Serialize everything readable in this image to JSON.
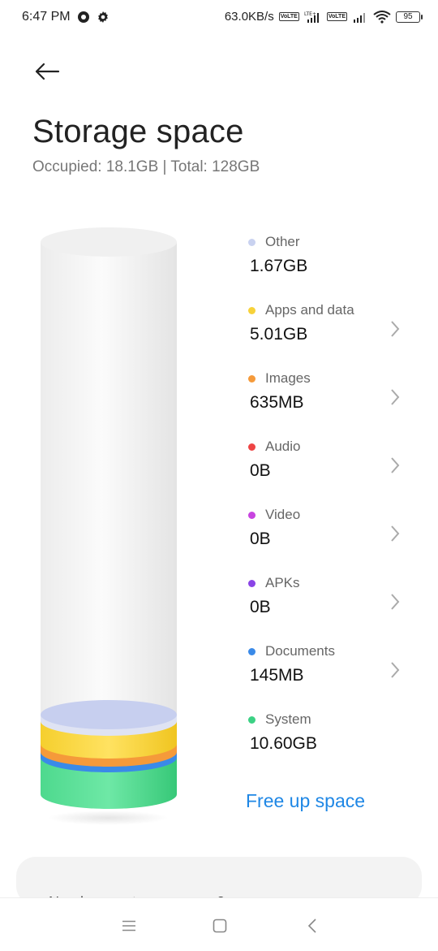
{
  "status_bar": {
    "time": "6:47 PM",
    "net_speed": "63.0KB/s",
    "lte_label": "LTE+",
    "volte_label": "Vo LTE",
    "battery": "95",
    "icons": [
      "circle-record-icon",
      "gear-icon",
      "volte-icon",
      "signal-icon",
      "wifi-icon",
      "battery-icon"
    ]
  },
  "header": {
    "title": "Storage space",
    "subtitle": "Occupied: 18.1GB | Total: 128GB"
  },
  "legend": [
    {
      "label": "Other",
      "value": "1.67GB",
      "color": "#c9d2f0",
      "chevron": false
    },
    {
      "label": "Apps and data",
      "value": "5.01GB",
      "color": "#f7d23a",
      "chevron": true
    },
    {
      "label": "Images",
      "value": "635MB",
      "color": "#f59a3a",
      "chevron": true
    },
    {
      "label": "Audio",
      "value": "0B",
      "color": "#ee4444",
      "chevron": true
    },
    {
      "label": "Video",
      "value": "0B",
      "color": "#c844e0",
      "chevron": true
    },
    {
      "label": "APKs",
      "value": "0B",
      "color": "#8a44e6",
      "chevron": true
    },
    {
      "label": "Documents",
      "value": "145MB",
      "color": "#3a8ae8",
      "chevron": true
    },
    {
      "label": "System",
      "value": "10.60GB",
      "color": "#3bd184",
      "chevron": false
    }
  ],
  "actions": {
    "free_up": "Free up space"
  },
  "card": {
    "text": "Need more storage space?"
  },
  "nav": {
    "icons": [
      "menu-icon",
      "home-icon",
      "back-icon"
    ]
  }
}
